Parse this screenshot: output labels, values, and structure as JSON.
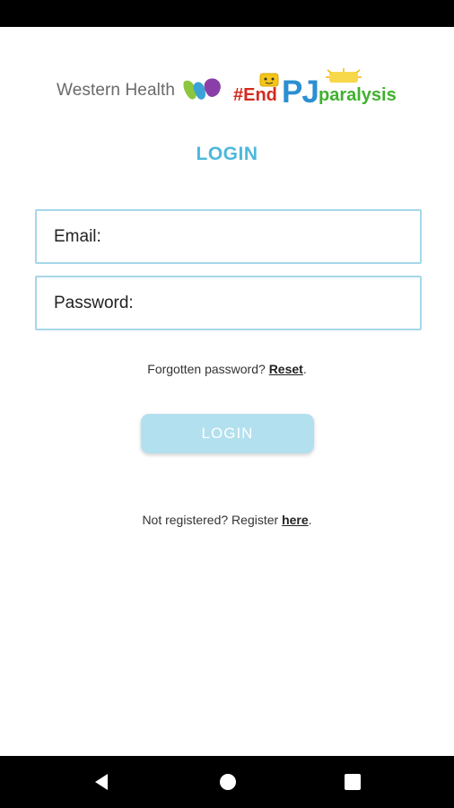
{
  "branding": {
    "org_name": "Western Health",
    "campaign_hash_end": "#End",
    "campaign_pj": "PJ",
    "campaign_paralysis": "paralysis",
    "colors": {
      "purple": "#8a3fa8",
      "blue": "#3aa2d6",
      "green": "#8cc63f",
      "red": "#d42a1f",
      "campaign_green": "#3fb12e",
      "campaign_blue": "#2c8fd1"
    }
  },
  "login": {
    "title": "LOGIN",
    "email_label": "Email:",
    "email_value": "",
    "password_label": "Password:",
    "password_value": "",
    "forgot_text": "Forgotten password?",
    "reset_link": "Reset",
    "forgot_suffix": ".",
    "button_label": "LOGIN",
    "register_text": "Not registered? Register",
    "register_link": "here",
    "register_suffix": "."
  },
  "theme": {
    "accent": "#4db8dc",
    "field_border": "#a6d7ea",
    "button_bg": "#b3e0ee"
  },
  "nav": {
    "icons": [
      "back-triangle-icon",
      "home-circle-icon",
      "recent-square-icon"
    ]
  }
}
